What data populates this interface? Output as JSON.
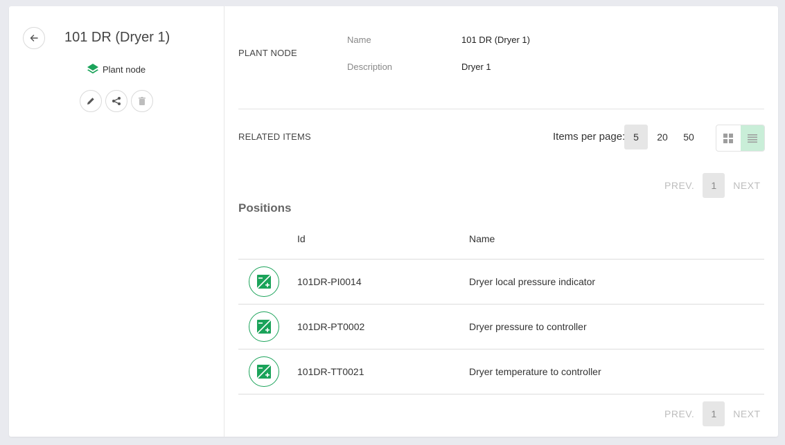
{
  "header": {
    "title": "101 DR (Dryer 1)",
    "type_label": "Plant node"
  },
  "details": {
    "section_label": "PLANT NODE",
    "fields": [
      {
        "label": "Name",
        "value": "101 DR (Dryer 1)"
      },
      {
        "label": "Description",
        "value": "Dryer 1"
      }
    ]
  },
  "related": {
    "section_label": "RELATED ITEMS",
    "items_per_page_label": "Items per page:",
    "items_per_page_options": [
      "5",
      "20",
      "50"
    ],
    "items_per_page_selected": "5",
    "pager": {
      "prev": "PREV.",
      "page": "1",
      "next": "NEXT"
    }
  },
  "positions": {
    "title": "Positions",
    "columns": {
      "id": "Id",
      "name": "Name"
    },
    "rows": [
      {
        "id": "101DR-PI0014",
        "name": "Dryer local pressure indicator"
      },
      {
        "id": "101DR-PT0002",
        "name": "Dryer pressure to controller"
      },
      {
        "id": "101DR-TT0021",
        "name": "Dryer temperature to controller"
      }
    ]
  },
  "colors": {
    "accent": "#1ba35a",
    "active_view": "#c9eed8"
  },
  "icons": {
    "back": "arrow-left-icon",
    "type": "layers-icon",
    "edit": "pencil-icon",
    "share": "share-icon",
    "delete": "trash-icon",
    "grid_view": "grid-icon",
    "list_view": "list-icon",
    "position": "position-icon"
  }
}
